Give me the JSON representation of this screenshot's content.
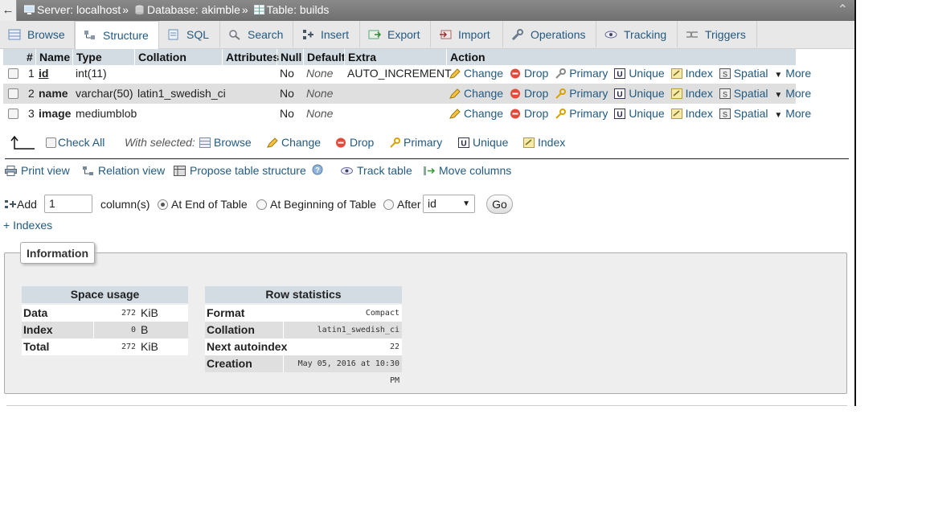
{
  "breadcrumb": {
    "back_glyph": "←",
    "server_label": "Server: localhost",
    "sep1": "»",
    "database_label": "Database: akimble",
    "sep2": "»",
    "table_label": "Table: builds",
    "collapse_glyph": "⌃"
  },
  "tabs": [
    {
      "label": "Browse",
      "icon": "browse-icon"
    },
    {
      "label": "Structure",
      "icon": "structure-icon",
      "active": true
    },
    {
      "label": "SQL",
      "icon": "sql-icon"
    },
    {
      "label": "Search",
      "icon": "search-icon"
    },
    {
      "label": "Insert",
      "icon": "insert-icon"
    },
    {
      "label": "Export",
      "icon": "export-icon"
    },
    {
      "label": "Import",
      "icon": "import-icon"
    },
    {
      "label": "Operations",
      "icon": "wrench-icon"
    },
    {
      "label": "Tracking",
      "icon": "eye-icon"
    },
    {
      "label": "Triggers",
      "icon": "triggers-icon"
    }
  ],
  "structure": {
    "headers": {
      "num": "#",
      "name": "Name",
      "type": "Type",
      "collation": "Collation",
      "attributes": "Attributes",
      "null": "Null",
      "default": "Default",
      "extra": "Extra",
      "action": "Action"
    },
    "rows": [
      {
        "num": "1",
        "name": "id",
        "type": "int(11)",
        "collation": "",
        "attributes": "",
        "null": "No",
        "default": "None",
        "extra": "AUTO_INCREMENT"
      },
      {
        "num": "2",
        "name": "name",
        "type": "varchar(50)",
        "collation": "latin1_swedish_ci",
        "attributes": "",
        "null": "No",
        "default": "None",
        "extra": ""
      },
      {
        "num": "3",
        "name": "image",
        "type": "mediumblob",
        "collation": "",
        "attributes": "",
        "null": "No",
        "default": "None",
        "extra": ""
      }
    ],
    "actions": {
      "change": "Change",
      "drop": "Drop",
      "primary": "Primary",
      "unique": "Unique",
      "index": "Index",
      "spatial": "Spatial",
      "more": "More"
    }
  },
  "with_selected": {
    "check_all": "Check All",
    "label": "With selected:",
    "browse": "Browse",
    "change": "Change",
    "drop": "Drop",
    "primary": "Primary",
    "unique": "Unique",
    "index": "Index"
  },
  "utilities": {
    "print_view": "Print view",
    "relation_view": "Relation view",
    "propose": "Propose table structure",
    "track_table": "Track table",
    "move_columns": "Move columns"
  },
  "add_column": {
    "add_label": "Add",
    "count": "1",
    "columns_label": "column(s)",
    "at_end": "At End of Table",
    "at_beginning": "At Beginning of Table",
    "after": "After",
    "after_value": "id",
    "go": "Go",
    "selected_option": "At End of Table"
  },
  "indexes_link": "+ Indexes",
  "information": {
    "legend": "Information",
    "space_usage": {
      "title": "Space usage",
      "rows": [
        {
          "label": "Data",
          "value": "272",
          "unit": "KiB"
        },
        {
          "label": "Index",
          "value": "0",
          "unit": "B"
        },
        {
          "label": "Total",
          "value": "272",
          "unit": "KiB"
        }
      ]
    },
    "row_statistics": {
      "title": "Row statistics",
      "rows": [
        {
          "label": "Format",
          "value": "Compact"
        },
        {
          "label": "Collation",
          "value": "latin1_swedish_ci"
        },
        {
          "label": "Next autoindex",
          "value": "22"
        },
        {
          "label": "Creation",
          "value": "May 05, 2016 at 10:30 PM"
        }
      ]
    }
  },
  "colors": {
    "link": "#235a81",
    "header_bg": "#d3dce3",
    "tab_bg": "#e8e8e8",
    "top_bar": "#7a7a7a"
  }
}
